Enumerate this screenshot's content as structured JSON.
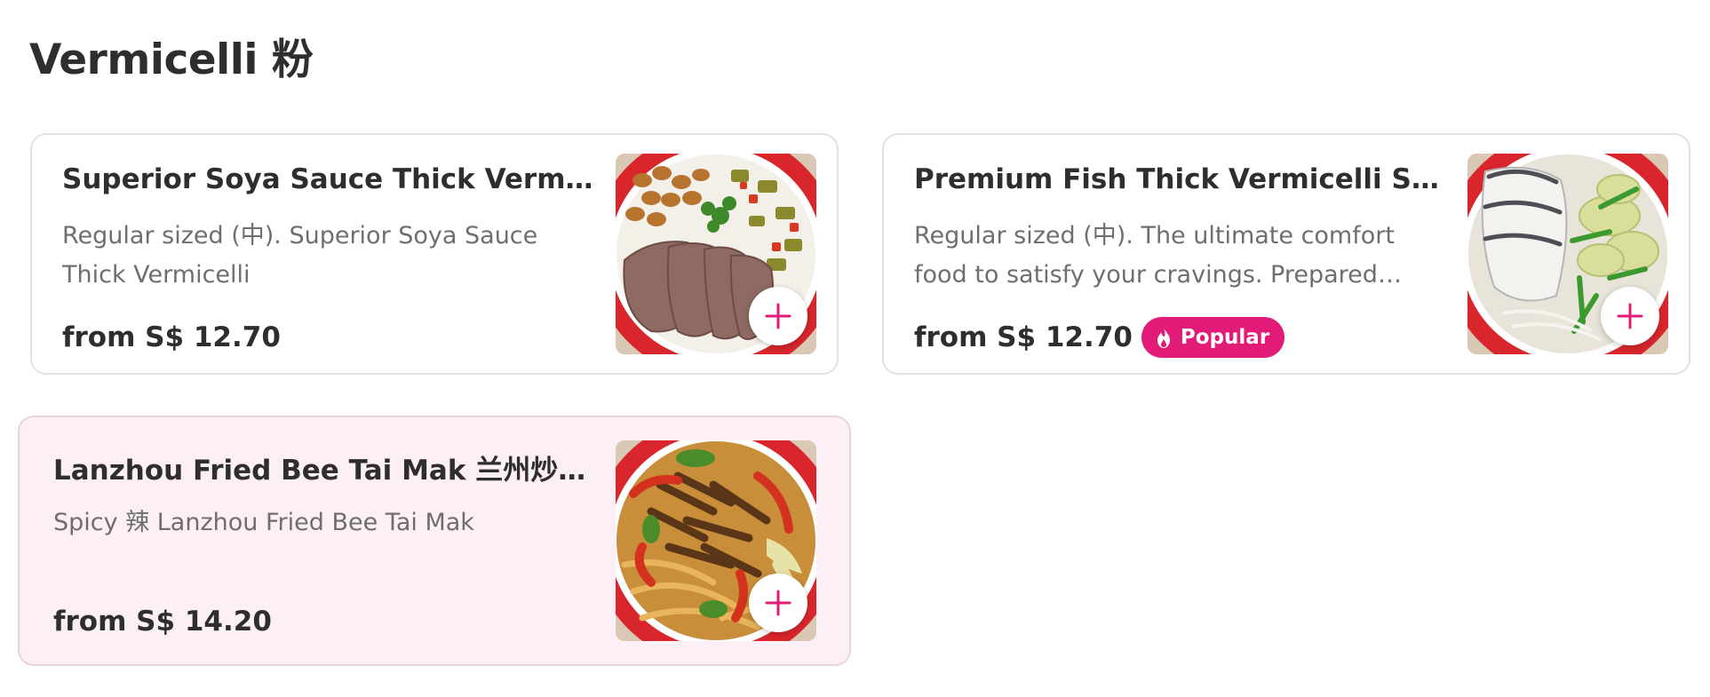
{
  "section": {
    "title": "Vermicelli 粉"
  },
  "items": [
    {
      "name": "Superior Soya Sauce Thick Vermicelli 特色卤肉粉",
      "description": "Regular sized (中). Superior Soya Sauce Thick Vermicelli",
      "price": "from S$ 12.70",
      "thumbnail_icon": "plus-icon"
    },
    {
      "name": "Premium Fish Thick Vermicelli Soup 鱼片粉",
      "description": "Regular sized (中). The ultimate comfort food to satisfy your cravings. Prepared with...",
      "price": "from S$ 12.70",
      "badge": "Popular",
      "thumbnail_icon": "plus-icon"
    },
    {
      "name": "Lanzhou Fried Bee Tai Mak 兰州炒老鼠粉",
      "description": "Spicy 辣 Lanzhou Fried Bee Tai Mak",
      "price": "from S$ 14.20",
      "thumbnail_icon": "plus-icon"
    }
  ],
  "colors": {
    "accent": "#e21b78",
    "highlight_background": "#fcf0f6",
    "text_primary": "#2e2e2e",
    "text_secondary": "#6e6e6e",
    "card_border": "#e2e2e2"
  }
}
